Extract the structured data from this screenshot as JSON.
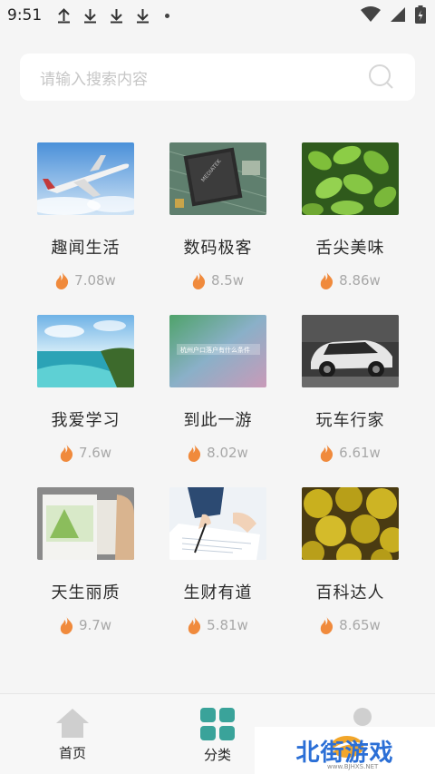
{
  "status": {
    "time": "9:51"
  },
  "search": {
    "placeholder": "请输入搜索内容"
  },
  "categories": [
    {
      "title": "趣闻生活",
      "heat": "7.08w"
    },
    {
      "title": "数码极客",
      "heat": "8.5w"
    },
    {
      "title": "舌尖美味",
      "heat": "8.86w"
    },
    {
      "title": "我爱学习",
      "heat": "7.6w"
    },
    {
      "title": "到此一游",
      "heat": "8.02w"
    },
    {
      "title": "玩车行家",
      "heat": "6.61w"
    },
    {
      "title": "天生丽质",
      "heat": "9.7w"
    },
    {
      "title": "生财有道",
      "heat": "5.81w"
    },
    {
      "title": "百科达人",
      "heat": "8.65w"
    }
  ],
  "thumb_texts": {
    "chip": "MEDIATEK",
    "travel": "杭州户口落户有什么条件"
  },
  "tabs": {
    "home": "首页",
    "category": "分类"
  },
  "watermark": {
    "brand": "北街游戏",
    "site": "www.BJHXS.NET"
  },
  "colors": {
    "accent": "#3aa39a",
    "fire": "#f08a3c",
    "tab_inactive": "#cfcfcf"
  }
}
